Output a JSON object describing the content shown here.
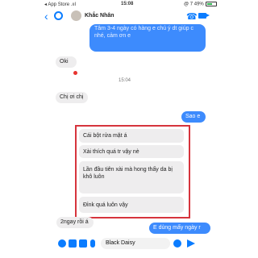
{
  "status": {
    "carrier": "◂ App Store .ııl",
    "time": "15:08",
    "battery": "@ 7 49%"
  },
  "header": {
    "name": "Khắc Nhân"
  },
  "messages": {
    "top_partial": "Tâm 3-4 ngày có hàng e chú ý dt giúp c nhé, cảm ơn e",
    "oki": "Oki",
    "timestamp": "15:04",
    "chi_oi": "Chị ơi chị",
    "sao_e": "Sao e",
    "quotes": [
      "Cái bột rửa mặt á",
      "Xài thích quá tr vậy nè",
      "Lần đầu tiên xài mà hong thấy da bị khô luôn",
      "Đỉnk quá luôn vậy"
    ],
    "e_dung": "E dùng mấy ngày r",
    "hai_ngay": "2ngay rồi á"
  },
  "composer": {
    "text": "Black Daisy"
  },
  "colors": {
    "accent": "#0a7cff",
    "bubble_blue": "#3d8bfd",
    "bubble_gray": "#eeedee",
    "highlight_box": "#d6343d"
  }
}
